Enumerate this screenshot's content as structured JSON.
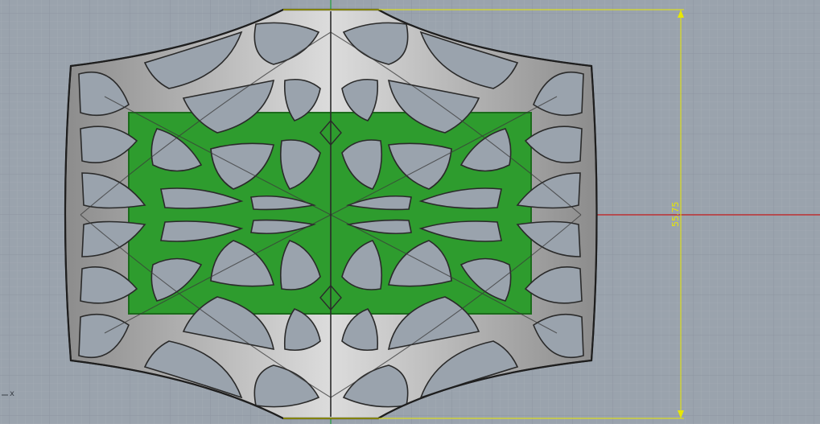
{
  "viewport": {
    "background_color": "#9aa3ad",
    "grid_minor_color": "#a8b0b9",
    "grid_major_color": "#8d96a1",
    "x_axis_color": "#c81e1e",
    "y_axis_color": "#1f9e3a",
    "dimension_color": "#e8e800",
    "model_outline_color": "#2a2a2a",
    "model_surface_color": "#b9b9b9",
    "model_inner_color": "#2e9c2e"
  },
  "dimension": {
    "value": "55.75"
  },
  "axis_widget": {
    "x_label": "x"
  }
}
